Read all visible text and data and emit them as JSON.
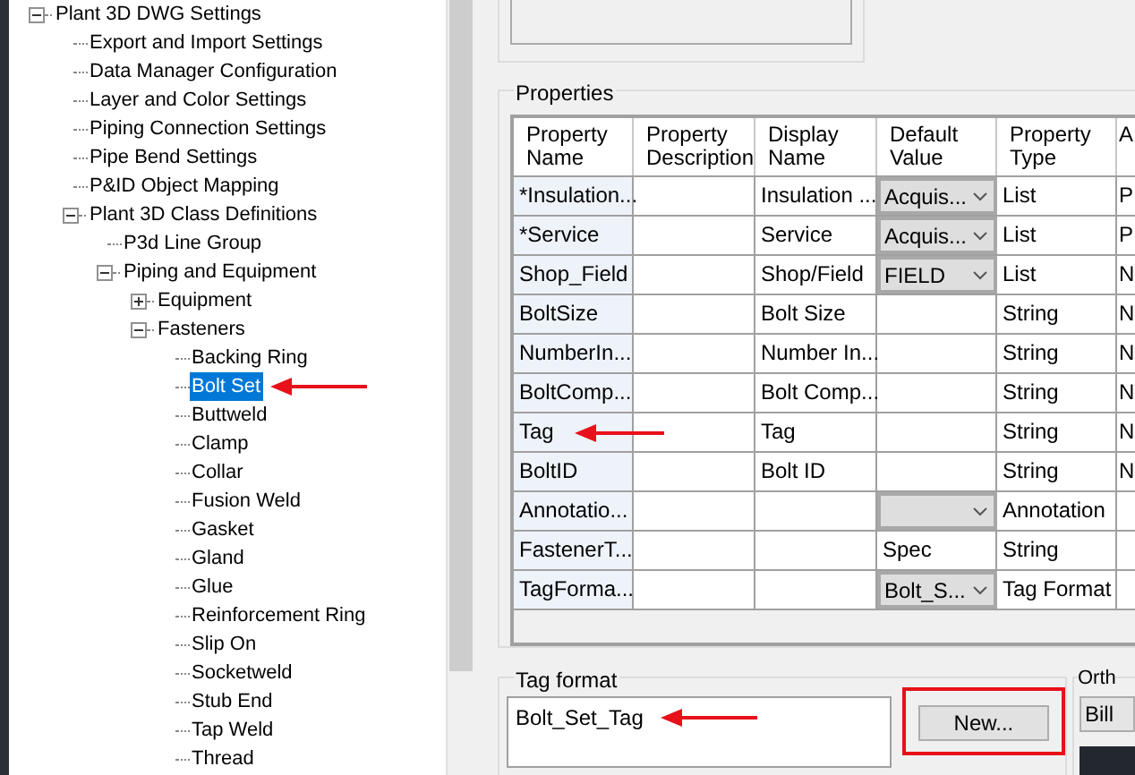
{
  "tree": [
    {
      "label": "Plant 3D DWG Settings",
      "expanded": true,
      "selected": false,
      "children": [
        {
          "label": "Export and Import Settings",
          "selected": false
        },
        {
          "label": "Data Manager Configuration",
          "selected": false
        },
        {
          "label": "Layer and Color Settings",
          "selected": false
        },
        {
          "label": "Piping Connection Settings",
          "selected": false
        },
        {
          "label": "Pipe Bend Settings",
          "selected": false
        },
        {
          "label": "P&ID Object Mapping",
          "selected": false
        },
        {
          "label": "Plant 3D Class Definitions",
          "expanded": true,
          "selected": false,
          "children": [
            {
              "label": "P3d Line Group",
              "selected": false
            },
            {
              "label": "Piping and Equipment",
              "expanded": true,
              "selected": false,
              "children": [
                {
                  "label": "Equipment",
                  "expanded": false,
                  "selected": false
                },
                {
                  "label": "Fasteners",
                  "expanded": true,
                  "selected": false,
                  "children": [
                    {
                      "label": "Backing Ring",
                      "selected": false
                    },
                    {
                      "label": "Bolt Set",
                      "selected": true,
                      "arrow": true
                    },
                    {
                      "label": "Buttweld",
                      "selected": false
                    },
                    {
                      "label": "Clamp",
                      "selected": false
                    },
                    {
                      "label": "Collar",
                      "selected": false
                    },
                    {
                      "label": "Fusion Weld",
                      "selected": false
                    },
                    {
                      "label": "Gasket",
                      "selected": false
                    },
                    {
                      "label": "Gland",
                      "selected": false
                    },
                    {
                      "label": "Glue",
                      "selected": false
                    },
                    {
                      "label": "Reinforcement Ring",
                      "selected": false
                    },
                    {
                      "label": "Slip On",
                      "selected": false
                    },
                    {
                      "label": "Socketweld",
                      "selected": false
                    },
                    {
                      "label": "Stub End",
                      "selected": false
                    },
                    {
                      "label": "Tap Weld",
                      "selected": false
                    },
                    {
                      "label": "Thread",
                      "selected": false
                    }
                  ]
                }
              ]
            }
          ]
        }
      ]
    }
  ],
  "properties": {
    "title": "Properties",
    "columns": [
      "Property Name",
      "Property Description",
      "Display Name",
      "Default Value",
      "Property Type",
      "A"
    ],
    "rows": [
      {
        "name": "*Insulation...",
        "display": "Insulation ...",
        "default": {
          "kind": "combo",
          "value": "Acquis..."
        },
        "type": "List",
        "column_6": "P"
      },
      {
        "name": "*Service",
        "display": "Service",
        "default": {
          "kind": "combo",
          "value": "Acquis..."
        },
        "type": "List",
        "column_6": "P"
      },
      {
        "name": "Shop_Field",
        "display": "Shop/Field",
        "default": {
          "kind": "combo",
          "value": "FIELD"
        },
        "type": "List",
        "column_6": "N"
      },
      {
        "name": "BoltSize",
        "display": "Bolt Size",
        "default": {
          "kind": "text"
        },
        "type": "String",
        "column_6": "N"
      },
      {
        "name": "NumberIn...",
        "display": "Number In...",
        "default": {
          "kind": "text"
        },
        "type": "String",
        "column_6": "N"
      },
      {
        "name": "BoltComp...",
        "display": "Bolt Comp...",
        "default": {
          "kind": "text"
        },
        "type": "String",
        "column_6": "N"
      },
      {
        "name": "Tag",
        "display": "Tag",
        "default": {
          "kind": "text"
        },
        "type": "String",
        "column_6": "N",
        "arrow": true
      },
      {
        "name": "BoltID",
        "display": "Bolt ID",
        "default": {
          "kind": "text"
        },
        "type": "String",
        "column_6": "N"
      },
      {
        "name": "Annotatio...",
        "default": {
          "kind": "combo"
        },
        "type": "Annotation"
      },
      {
        "name": "FastenerT...",
        "default": {
          "kind": "text",
          "value": "Spec"
        },
        "type": "String"
      },
      {
        "name": "TagForma...",
        "default": {
          "kind": "combo",
          "value": "Bolt_S..."
        },
        "type": "Tag Format"
      }
    ]
  },
  "tag_format": {
    "title": "Tag format",
    "items": [
      {
        "label": "Bolt_Set_Tag",
        "arrow": true
      }
    ],
    "new_button": "New...",
    "new_highlighted": true
  },
  "other": {
    "title": "Orth",
    "combo_value": "Bill"
  }
}
